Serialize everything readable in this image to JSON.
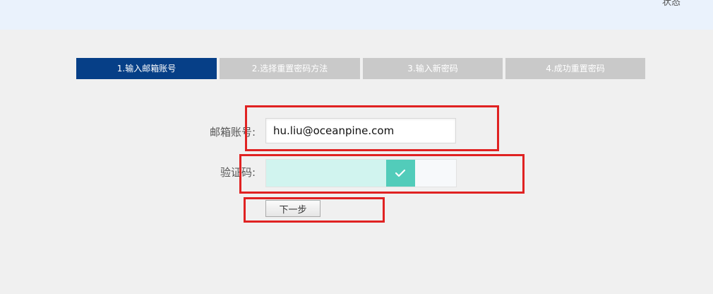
{
  "header": {
    "corner_text": "状态"
  },
  "steps": [
    {
      "label": "1.输入邮箱账号",
      "active": true
    },
    {
      "label": "2.选择重置密码方法",
      "active": false
    },
    {
      "label": "3.输入新密码",
      "active": false
    },
    {
      "label": "4.成功重置密码",
      "active": false
    }
  ],
  "form": {
    "email_label": "邮箱账号:",
    "email_value": "hu.liu@oceanpine.com",
    "captcha_label": "验证码:",
    "captcha_progress": 0.78,
    "next_button_label": "下一步"
  },
  "colors": {
    "active_step": "#063f87",
    "inactive_step": "#c9c9c9",
    "slider_fill": "#d1f4ef",
    "slider_handle": "#52ccba",
    "highlight": "#e02222"
  },
  "icons": {
    "slider_handle": "check-icon"
  }
}
